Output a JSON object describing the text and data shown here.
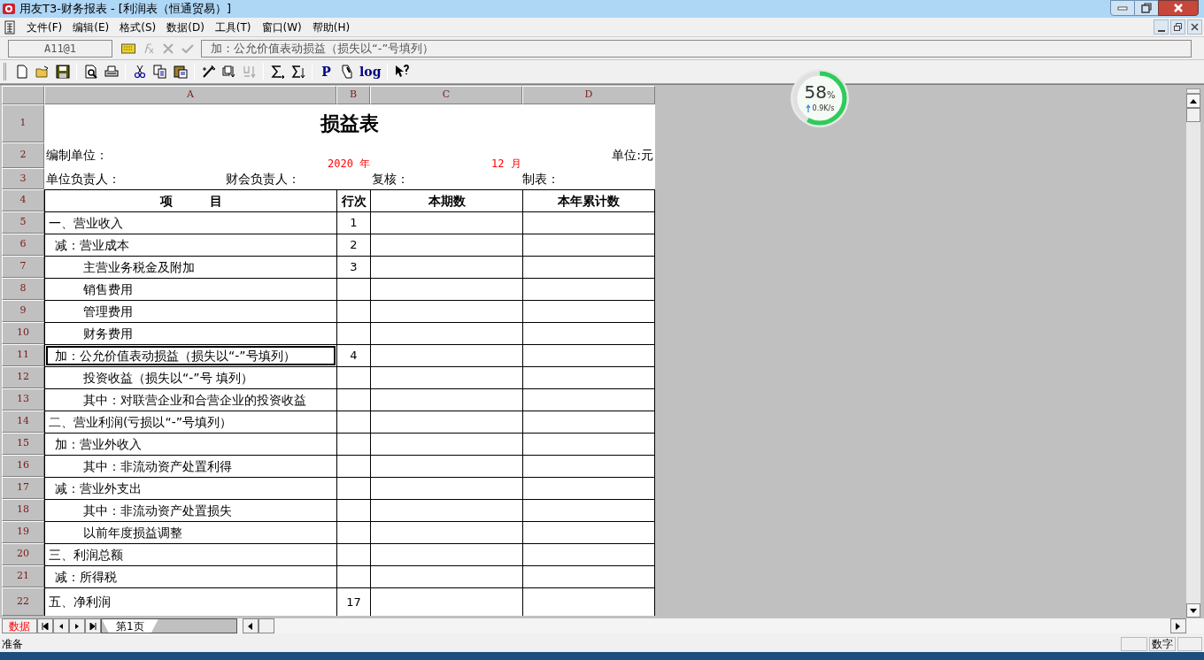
{
  "title_bar": {
    "title": "用友T3-财务报表 - [利润表（恒通贸易）]"
  },
  "menu": [
    "文件(F)",
    "编辑(E)",
    "格式(S)",
    "数据(D)",
    "工具(T)",
    "窗口(W)",
    "帮助(H)"
  ],
  "formula_bar": {
    "cell_ref": "A11@1",
    "content": "加：公允价值表动损益（损失以“-”号填列）"
  },
  "toolbar": [
    {
      "kind": "new"
    },
    {
      "kind": "open"
    },
    {
      "kind": "save"
    },
    {
      "kind": "sep"
    },
    {
      "kind": "preview"
    },
    {
      "kind": "print"
    },
    {
      "kind": "sep"
    },
    {
      "kind": "cut"
    },
    {
      "kind": "copy"
    },
    {
      "kind": "paste"
    },
    {
      "kind": "sep"
    },
    {
      "kind": "wand"
    },
    {
      "kind": "sortdown"
    },
    {
      "kind": "sortdis"
    },
    {
      "kind": "sep"
    },
    {
      "kind": "sum"
    },
    {
      "kind": "sumdown"
    },
    {
      "kind": "sep"
    },
    {
      "kind": "text",
      "label": "P"
    },
    {
      "kind": "pen"
    },
    {
      "kind": "text",
      "label": "log"
    },
    {
      "kind": "sep"
    },
    {
      "kind": "help"
    }
  ],
  "columns": [
    "A",
    "B",
    "C",
    "D"
  ],
  "row_headers": [
    "1",
    "2",
    "3",
    "4",
    "5",
    "6",
    "7",
    "8",
    "9",
    "10",
    "11",
    "12",
    "13",
    "14",
    "15",
    "16",
    "17",
    "18",
    "19",
    "20",
    "21",
    "22"
  ],
  "report": {
    "title": "损益表",
    "org_label": "编制单位：",
    "year": "2020 年",
    "month": "12 月",
    "unit": "单位:元",
    "signers": [
      "单位负责人：",
      "财会负责人：",
      "复核：",
      "制表："
    ],
    "header": [
      "项　　　目",
      "行次",
      "本期数",
      "本年累计数"
    ],
    "items": [
      {
        "label": "一、营业收入",
        "kind": "section",
        "line": "1",
        "selected": false
      },
      {
        "label": "减：营业成本",
        "kind": "sub",
        "line": "2",
        "selected": false
      },
      {
        "label": "主营业务税金及附加",
        "kind": "detail",
        "line": "3",
        "selected": false
      },
      {
        "label": "销售费用",
        "kind": "detail",
        "selected": false
      },
      {
        "label": "管理费用",
        "kind": "detail",
        "selected": false
      },
      {
        "label": "财务费用",
        "kind": "detail",
        "selected": false
      },
      {
        "label": "加：公允价值表动损益（损失以“-”号填列）",
        "kind": "sub",
        "line": "4",
        "selected": true
      },
      {
        "label": "投资收益（损失以“-”号 填列）",
        "kind": "detail",
        "selected": false
      },
      {
        "label": "其中：对联营企业和合营企业的投资收益",
        "kind": "detail",
        "selected": false
      },
      {
        "label": "二、营业利润(亏损以“-”号填列）",
        "kind": "section",
        "selected": false
      },
      {
        "label": "加：营业外收入",
        "kind": "sub",
        "selected": false
      },
      {
        "label": "其中：非流动资产处置利得",
        "kind": "detail",
        "selected": false
      },
      {
        "label": "减：营业外支出",
        "kind": "sub",
        "selected": false
      },
      {
        "label": "其中：非流动资产处置损失",
        "kind": "detail",
        "selected": false
      },
      {
        "label": "以前年度损益调整",
        "kind": "detail",
        "selected": false
      },
      {
        "label": "三、利润总额",
        "kind": "section",
        "selected": false
      },
      {
        "label": "减：所得税",
        "kind": "sub",
        "selected": false
      },
      {
        "label": "五、净利润",
        "kind": "section",
        "line": "17",
        "selected": false
      }
    ]
  },
  "net_monitor": {
    "percent": "58",
    "unit": "%",
    "level": 0.58,
    "speed": "0.9K/s"
  },
  "sheet_bar": {
    "mode": "数据",
    "tabs": [
      {
        "label": "第1页",
        "selected": true
      }
    ]
  },
  "status_bar": {
    "message": "准备",
    "num_indicator": "数字"
  }
}
